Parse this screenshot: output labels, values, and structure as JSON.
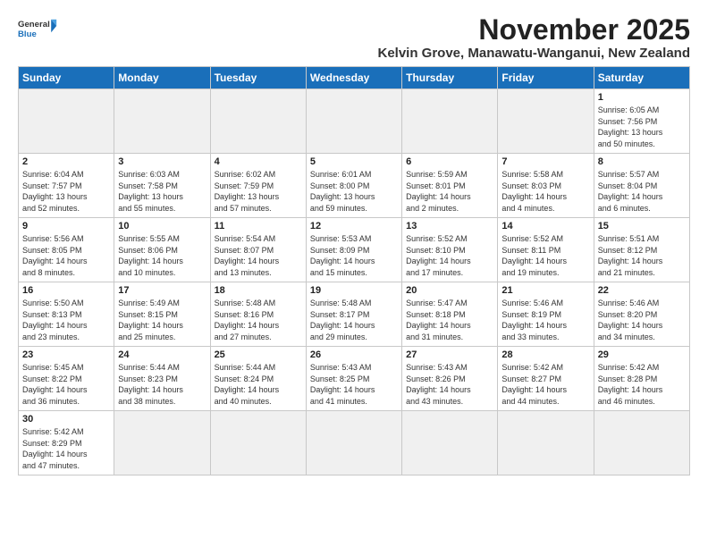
{
  "header": {
    "logo_general": "General",
    "logo_blue": "Blue",
    "month": "November 2025",
    "location": "Kelvin Grove, Manawatu-Wanganui, New Zealand"
  },
  "weekdays": [
    "Sunday",
    "Monday",
    "Tuesday",
    "Wednesday",
    "Thursday",
    "Friday",
    "Saturday"
  ],
  "weeks": [
    [
      {
        "day": "",
        "info": ""
      },
      {
        "day": "",
        "info": ""
      },
      {
        "day": "",
        "info": ""
      },
      {
        "day": "",
        "info": ""
      },
      {
        "day": "",
        "info": ""
      },
      {
        "day": "",
        "info": ""
      },
      {
        "day": "1",
        "info": "Sunrise: 6:05 AM\nSunset: 7:56 PM\nDaylight: 13 hours\nand 50 minutes."
      }
    ],
    [
      {
        "day": "2",
        "info": "Sunrise: 6:04 AM\nSunset: 7:57 PM\nDaylight: 13 hours\nand 52 minutes."
      },
      {
        "day": "3",
        "info": "Sunrise: 6:03 AM\nSunset: 7:58 PM\nDaylight: 13 hours\nand 55 minutes."
      },
      {
        "day": "4",
        "info": "Sunrise: 6:02 AM\nSunset: 7:59 PM\nDaylight: 13 hours\nand 57 minutes."
      },
      {
        "day": "5",
        "info": "Sunrise: 6:01 AM\nSunset: 8:00 PM\nDaylight: 13 hours\nand 59 minutes."
      },
      {
        "day": "6",
        "info": "Sunrise: 5:59 AM\nSunset: 8:01 PM\nDaylight: 14 hours\nand 2 minutes."
      },
      {
        "day": "7",
        "info": "Sunrise: 5:58 AM\nSunset: 8:03 PM\nDaylight: 14 hours\nand 4 minutes."
      },
      {
        "day": "8",
        "info": "Sunrise: 5:57 AM\nSunset: 8:04 PM\nDaylight: 14 hours\nand 6 minutes."
      }
    ],
    [
      {
        "day": "9",
        "info": "Sunrise: 5:56 AM\nSunset: 8:05 PM\nDaylight: 14 hours\nand 8 minutes."
      },
      {
        "day": "10",
        "info": "Sunrise: 5:55 AM\nSunset: 8:06 PM\nDaylight: 14 hours\nand 10 minutes."
      },
      {
        "day": "11",
        "info": "Sunrise: 5:54 AM\nSunset: 8:07 PM\nDaylight: 14 hours\nand 13 minutes."
      },
      {
        "day": "12",
        "info": "Sunrise: 5:53 AM\nSunset: 8:09 PM\nDaylight: 14 hours\nand 15 minutes."
      },
      {
        "day": "13",
        "info": "Sunrise: 5:52 AM\nSunset: 8:10 PM\nDaylight: 14 hours\nand 17 minutes."
      },
      {
        "day": "14",
        "info": "Sunrise: 5:52 AM\nSunset: 8:11 PM\nDaylight: 14 hours\nand 19 minutes."
      },
      {
        "day": "15",
        "info": "Sunrise: 5:51 AM\nSunset: 8:12 PM\nDaylight: 14 hours\nand 21 minutes."
      }
    ],
    [
      {
        "day": "16",
        "info": "Sunrise: 5:50 AM\nSunset: 8:13 PM\nDaylight: 14 hours\nand 23 minutes."
      },
      {
        "day": "17",
        "info": "Sunrise: 5:49 AM\nSunset: 8:15 PM\nDaylight: 14 hours\nand 25 minutes."
      },
      {
        "day": "18",
        "info": "Sunrise: 5:48 AM\nSunset: 8:16 PM\nDaylight: 14 hours\nand 27 minutes."
      },
      {
        "day": "19",
        "info": "Sunrise: 5:48 AM\nSunset: 8:17 PM\nDaylight: 14 hours\nand 29 minutes."
      },
      {
        "day": "20",
        "info": "Sunrise: 5:47 AM\nSunset: 8:18 PM\nDaylight: 14 hours\nand 31 minutes."
      },
      {
        "day": "21",
        "info": "Sunrise: 5:46 AM\nSunset: 8:19 PM\nDaylight: 14 hours\nand 33 minutes."
      },
      {
        "day": "22",
        "info": "Sunrise: 5:46 AM\nSunset: 8:20 PM\nDaylight: 14 hours\nand 34 minutes."
      }
    ],
    [
      {
        "day": "23",
        "info": "Sunrise: 5:45 AM\nSunset: 8:22 PM\nDaylight: 14 hours\nand 36 minutes."
      },
      {
        "day": "24",
        "info": "Sunrise: 5:44 AM\nSunset: 8:23 PM\nDaylight: 14 hours\nand 38 minutes."
      },
      {
        "day": "25",
        "info": "Sunrise: 5:44 AM\nSunset: 8:24 PM\nDaylight: 14 hours\nand 40 minutes."
      },
      {
        "day": "26",
        "info": "Sunrise: 5:43 AM\nSunset: 8:25 PM\nDaylight: 14 hours\nand 41 minutes."
      },
      {
        "day": "27",
        "info": "Sunrise: 5:43 AM\nSunset: 8:26 PM\nDaylight: 14 hours\nand 43 minutes."
      },
      {
        "day": "28",
        "info": "Sunrise: 5:42 AM\nSunset: 8:27 PM\nDaylight: 14 hours\nand 44 minutes."
      },
      {
        "day": "29",
        "info": "Sunrise: 5:42 AM\nSunset: 8:28 PM\nDaylight: 14 hours\nand 46 minutes."
      }
    ],
    [
      {
        "day": "30",
        "info": "Sunrise: 5:42 AM\nSunset: 8:29 PM\nDaylight: 14 hours\nand 47 minutes."
      },
      {
        "day": "",
        "info": ""
      },
      {
        "day": "",
        "info": ""
      },
      {
        "day": "",
        "info": ""
      },
      {
        "day": "",
        "info": ""
      },
      {
        "day": "",
        "info": ""
      },
      {
        "day": "",
        "info": ""
      }
    ]
  ]
}
